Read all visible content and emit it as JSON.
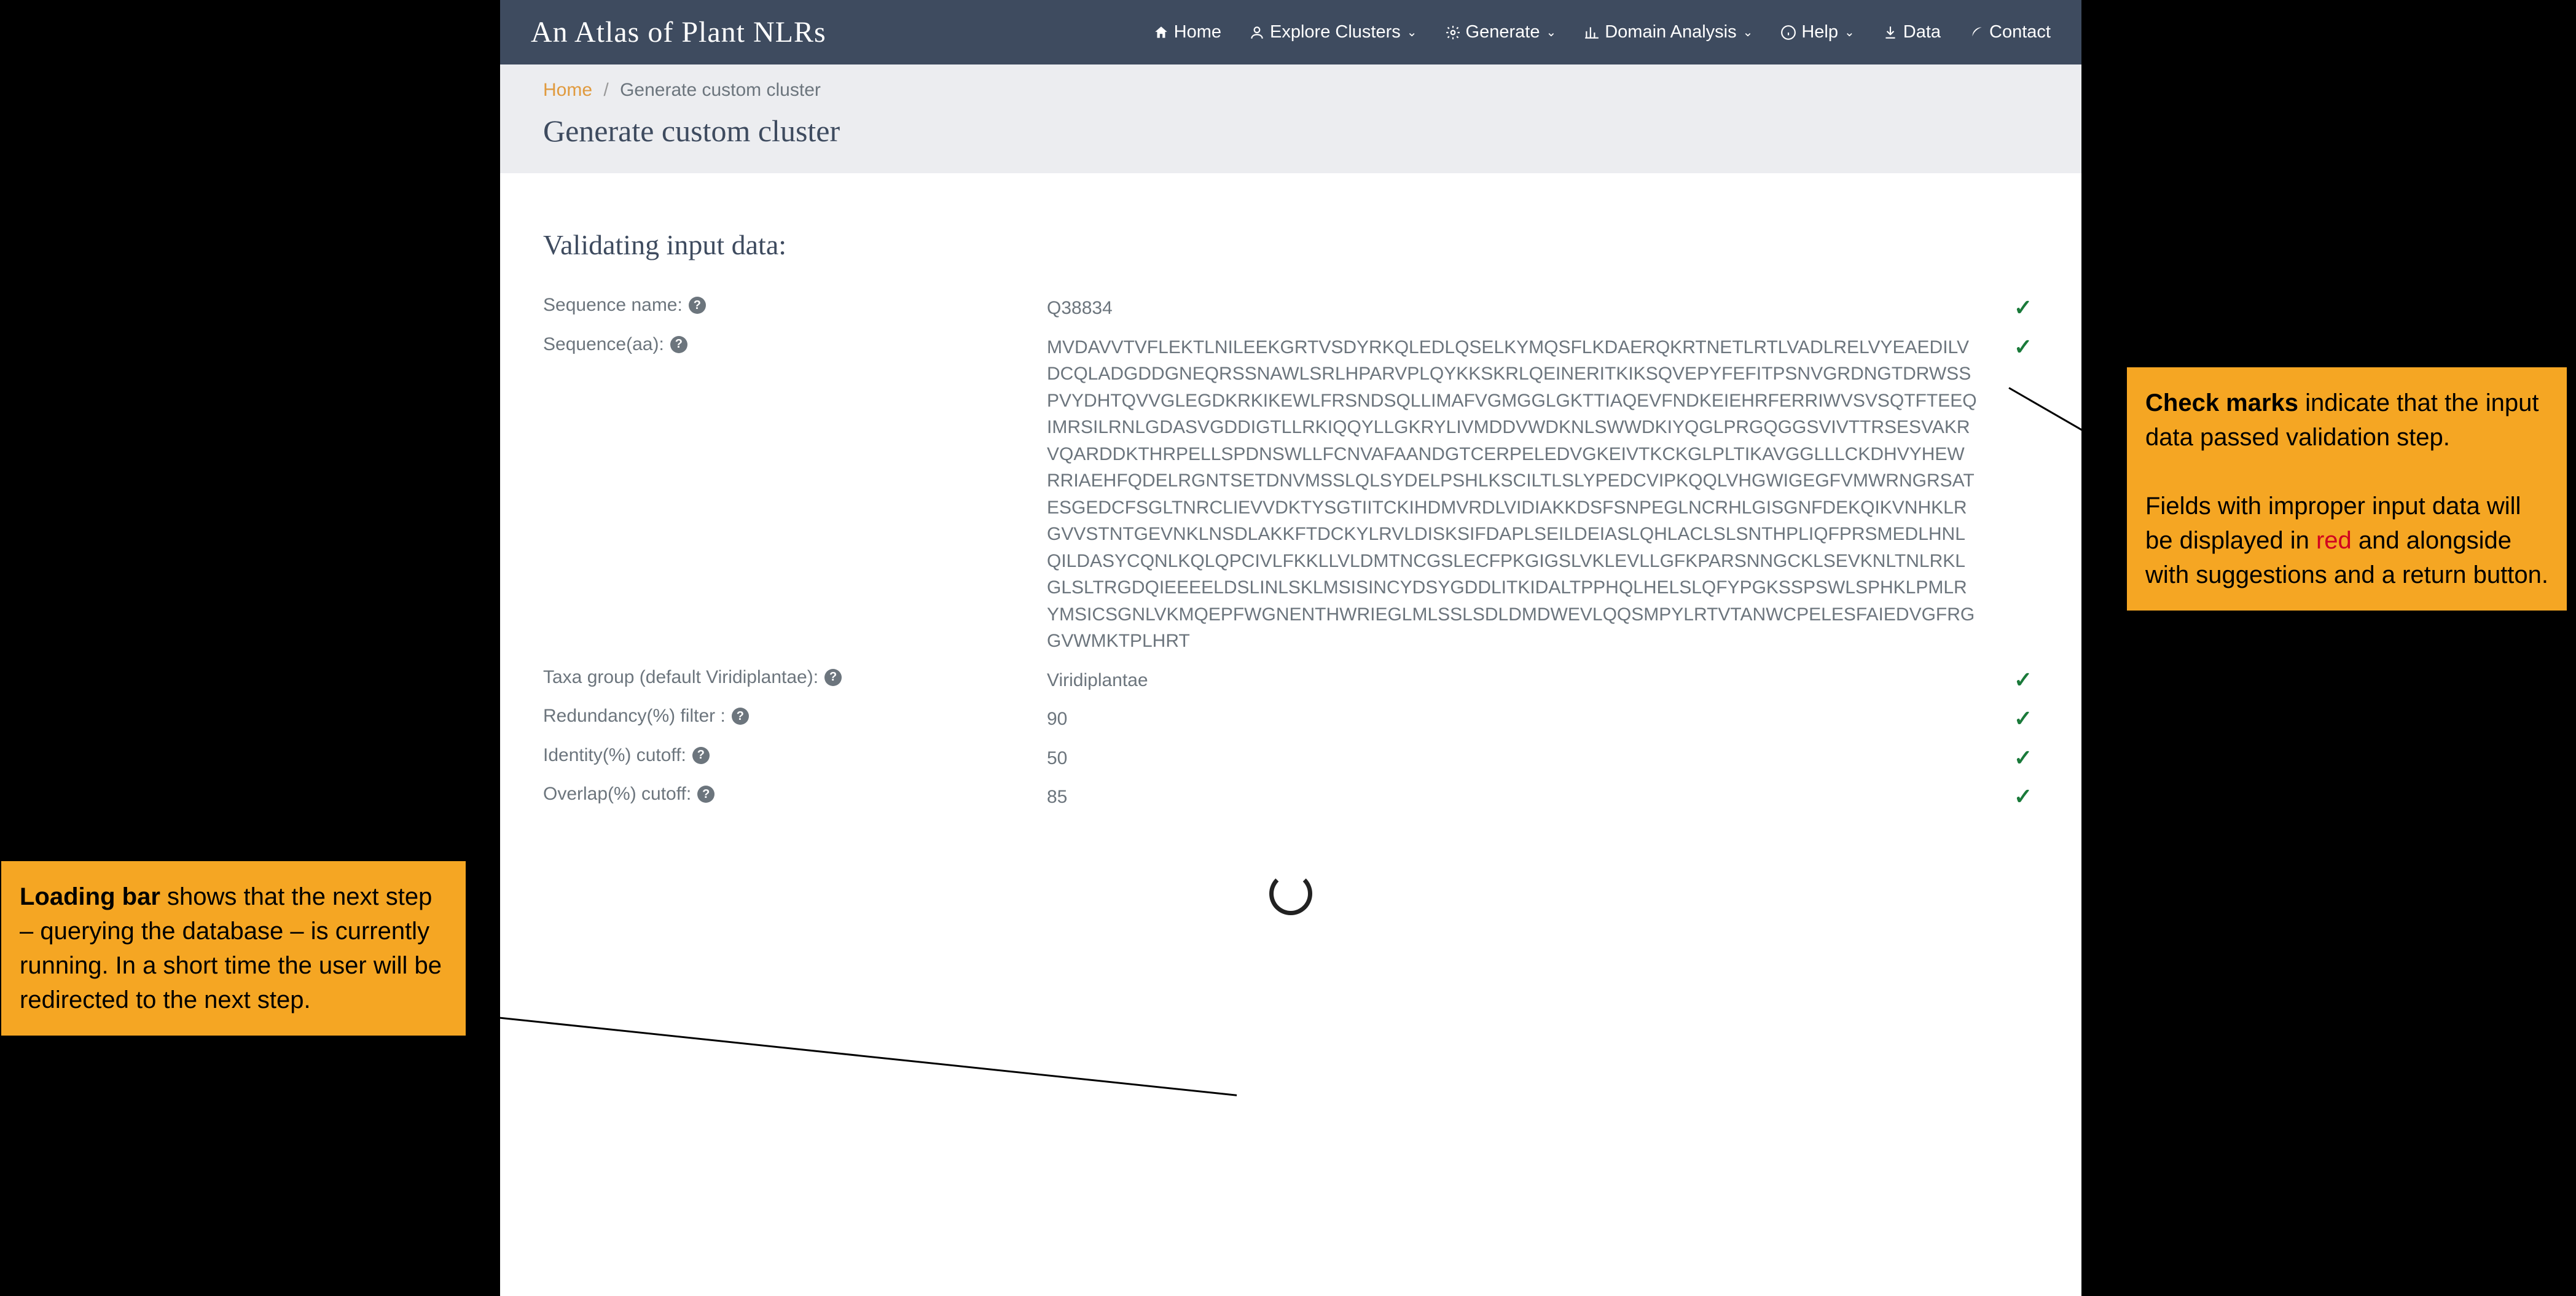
{
  "brand": "An Atlas of Plant NLRs",
  "nav": {
    "home": "Home",
    "explore": "Explore Clusters",
    "generate": "Generate",
    "domain": "Domain Analysis",
    "help": "Help",
    "data": "Data",
    "contact": "Contact"
  },
  "breadcrumb": {
    "home": "Home",
    "current": "Generate custom cluster"
  },
  "page_title": "Generate custom cluster",
  "section_title": "Validating input data:",
  "fields": {
    "seq_name": {
      "label": "Sequence name:",
      "value": "Q38834"
    },
    "seq_aa": {
      "label": "Sequence(aa):",
      "value": "MVDAVVTVFLEKTLNILEEKGRTVSDYRKQLEDLQSELKYMQSFLKDAERQKRTNETLRTLVADLRELVYEAEDILVDCQLADGDDGNEQRSSNAWLSRLHPARVPLQYKKSKRLQEINERITKIKSQVEPYFEFITPSNVGRDNGTDRWSSPVYDHTQVVGLEGDKRKIKEWLFRSNDSQLLIMAFVGMGGLGKTTIAQEVFNDKEIEHRFERRIWVSVSQTFTEEQIMRSILRNLGDASVGDDIGTLLRKIQQYLLGKRYLIVMDDVWDKNLSWWDKIYQGLPRGQGGSVIVTTRSESVAKRVQARDDKTHRPELLSPDNSWLLFCNVAFAANDGTCERPELEDVGKEIVTKCKGLPLTIKAVGGLLLCKDHVYHEWRRIAEHFQDELRGNTSETDNVMSSLQLSYDELPSHLKSCILTLSLYPEDCVIPKQQLVHGWIGEGFVMWRNGRSATESGEDCFSGLTNRCLIEVVDKTYSGTIITCKIHDMVRDLVIDIAKKDSFSNPEGLNCRHLGISGNFDEKQIKVNHKLRGVVSTNTGEVNKLNSDLAKKFTDCKYLRVLDISKSIFDAPLSEILDEIASLQHLACLSLSNTHPLIQFPRSMEDLHNLQILDASYCQNLKQLQPCIVLFKKLLVLDMTNCGSLECFPKGIGSLVKLEVLLGFKPARSNNGCKLSEVKNLTNLRKLGLSLTRGDQIEEEELDSLINLSKLMSISINCYDSYGDDLITKIDALTPPHQLHELSLQFYPGKSSPSWLSPHKLPMLRYMSICSGNLVKMQEPFWGNENTHWRIEGLMLSSLSDLDMDWEVLQQSMPYLRTVTANWCPELESFAIEDVGFRGGVWMKTPLHRT"
    },
    "taxa": {
      "label": "Taxa group (default Viridiplantae):",
      "value": "Viridiplantae"
    },
    "redundancy": {
      "label": "Redundancy(%) filter :",
      "value": "90"
    },
    "identity": {
      "label": "Identity(%) cutoff:",
      "value": "50"
    },
    "overlap": {
      "label": "Overlap(%) cutoff:",
      "value": "85"
    }
  },
  "callouts": {
    "right_bold": "Check marks",
    "right_1": " indicate that the input data passed validation step.",
    "right_2a": "Fields with improper input data will be displayed in ",
    "right_2b": "red",
    "right_2c": " and alongside with suggestions and a return button.",
    "left_bold": "Loading bar",
    "left_1": " shows that the next step – querying the database – is currently running. In a short time the user will be redirected to the next step."
  }
}
